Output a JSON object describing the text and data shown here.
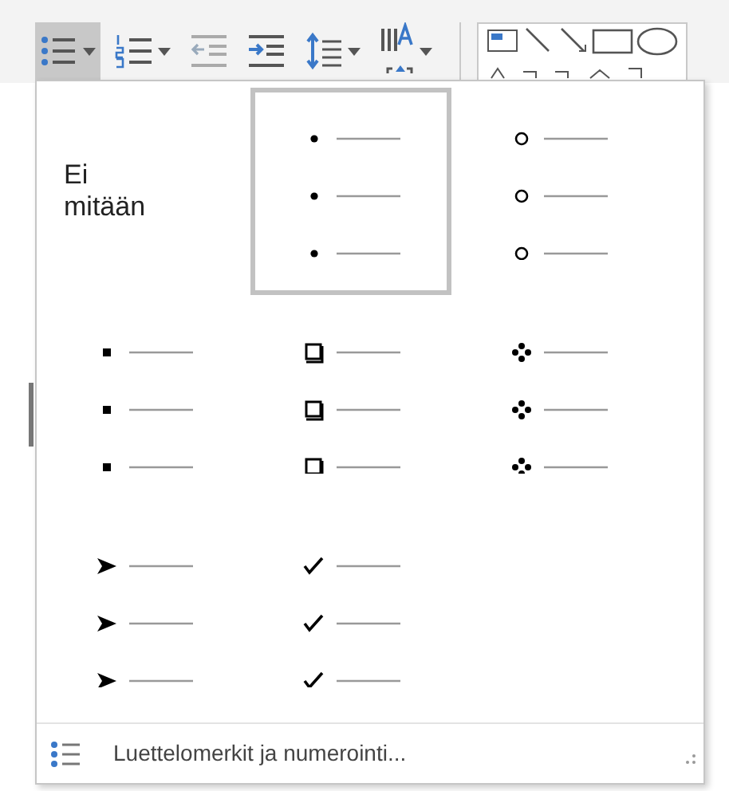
{
  "toolbar": {
    "buttons": [
      {
        "kind": "bullets",
        "selected": true,
        "dropdown": true
      },
      {
        "kind": "numbering",
        "selected": false,
        "dropdown": true
      },
      {
        "kind": "outdent",
        "selected": false,
        "dropdown": false
      },
      {
        "kind": "indent",
        "selected": false,
        "dropdown": false
      },
      {
        "kind": "spacing",
        "selected": false,
        "dropdown": true
      },
      {
        "kind": "direction",
        "selected": false,
        "dropdown": true
      }
    ]
  },
  "library": [
    {
      "kind": "none",
      "label": "Ei mitään",
      "selected": false
    },
    {
      "kind": "dot",
      "selected": true
    },
    {
      "kind": "circle",
      "selected": false
    },
    {
      "kind": "square",
      "selected": false
    },
    {
      "kind": "box",
      "selected": false
    },
    {
      "kind": "diamond",
      "selected": false
    },
    {
      "kind": "arrow",
      "selected": false
    },
    {
      "kind": "check",
      "selected": false
    }
  ],
  "footer": {
    "label": "Luettelomerkit ja numerointi..."
  }
}
